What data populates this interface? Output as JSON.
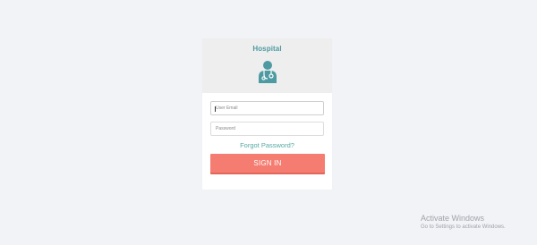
{
  "brand": {
    "title": "Hospital",
    "icon": "doctor-icon"
  },
  "form": {
    "email_placeholder": "User Email",
    "email_value": "",
    "password_placeholder": "Password",
    "password_value": "",
    "forgot_label": "Forgot Password?",
    "signin_label": "SIGN IN"
  },
  "watermark": {
    "title": "Activate Windows",
    "subtitle": "Go to Settings to activate Windows."
  },
  "colors": {
    "background": "#f2f3f7",
    "header_bg": "#eeeeee",
    "brand_teal": "#4d9aa2",
    "link_teal": "#55a9a3",
    "button_coral": "#f57c70"
  }
}
